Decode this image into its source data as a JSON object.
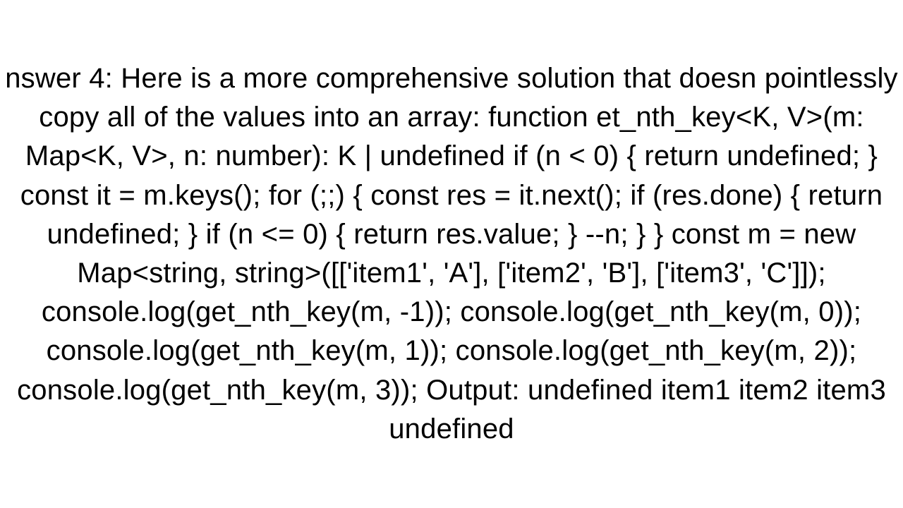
{
  "document": {
    "text": "nswer 4: Here is a more comprehensive solution that doesn pointlessly copy all of the values into an array: function et_nth_key<K, V>(m: Map<K, V>, n: number): K | undefined if (n < 0) {     return undefined;   }   const it = m.keys();   for (;;) {     const res = it.next();     if (res.done) {       return undefined;     }     if (n <= 0) {       return res.value;     }     --n;   } }  const m = new Map<string, string>([['item1', 'A'], ['item2', 'B'], ['item3', 'C']]);  console.log(get_nth_key(m, -1)); console.log(get_nth_key(m, 0)); console.log(get_nth_key(m, 1)); console.log(get_nth_key(m, 2)); console.log(get_nth_key(m, 3));  Output: undefined item1 item2 item3 undefined"
  }
}
